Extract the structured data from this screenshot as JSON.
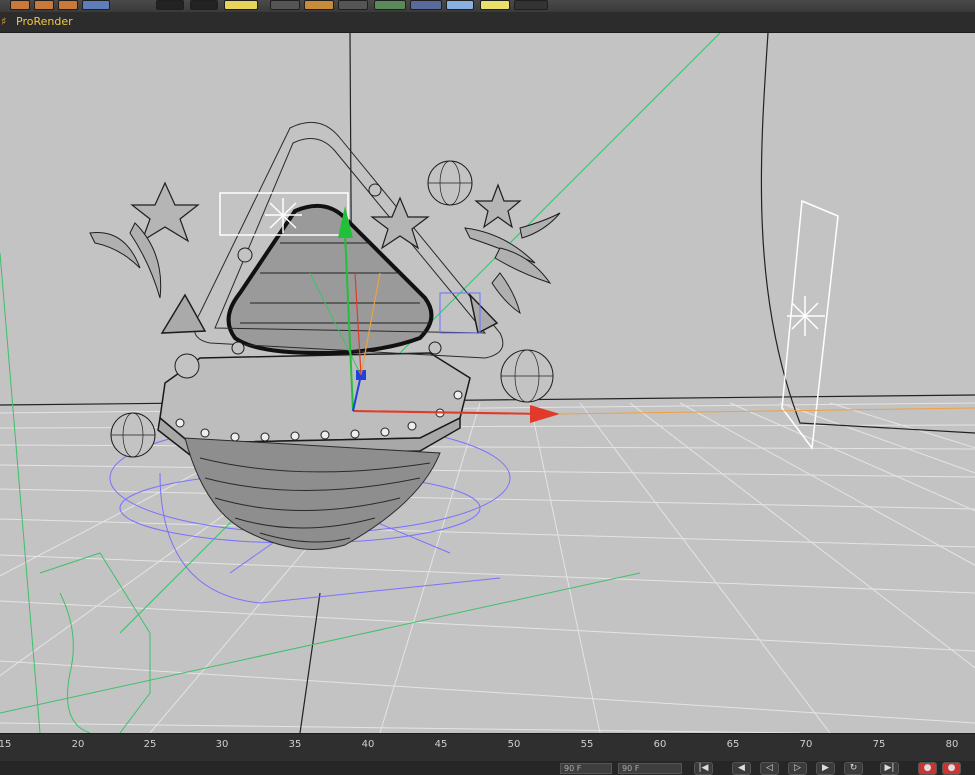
{
  "menubar": {
    "label": "ProRender"
  },
  "timeline": {
    "ticks": [
      "15",
      "20",
      "25",
      "30",
      "35",
      "40",
      "45",
      "50",
      "55",
      "60",
      "65",
      "70",
      "75",
      "80"
    ]
  },
  "transport": {
    "current_frame": "90 F",
    "end_frame": "90 F",
    "buttons": [
      "go-to-start",
      "step-back",
      "play-reverse",
      "play",
      "step-forward",
      "go-to-end",
      "record"
    ]
  },
  "colors": {
    "viewport_bg": "#c3c3c3",
    "grid": "#e6e6e6",
    "axis_x": "#e23a2a",
    "axis_y": "#22c03a",
    "axis_z": "#2040e0",
    "accent": "#f0c84a"
  }
}
